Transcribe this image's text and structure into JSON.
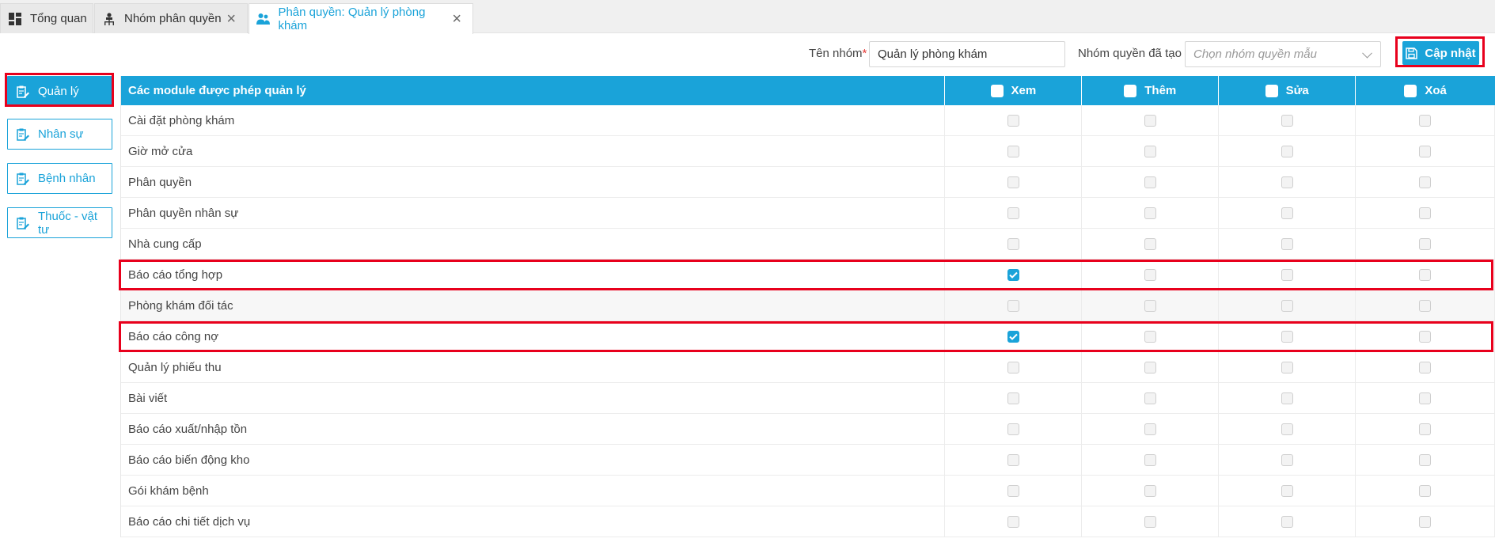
{
  "tabs": [
    {
      "label": "Tổng quan",
      "icon": "dashboard-icon"
    },
    {
      "label": "Nhóm phân quyền",
      "icon": "org-chart-icon"
    },
    {
      "label": "Phân quyền: Quản lý phòng khám",
      "icon": "users-icon"
    }
  ],
  "toolbar": {
    "group_name_label": "Tên nhóm",
    "required_mark": "*",
    "group_name_value": "Quản lý phòng khám",
    "template_label": "Nhóm quyền đã tạo :",
    "template_placeholder": "Chọn nhóm quyền mẫu",
    "update_label": "Cập nhật"
  },
  "sidebar": {
    "items": [
      {
        "label": "Quản lý",
        "active": true
      },
      {
        "label": "Nhân sự",
        "active": false
      },
      {
        "label": "Bệnh nhân",
        "active": false
      },
      {
        "label": "Thuốc - vật tư",
        "active": false
      }
    ]
  },
  "table": {
    "header": {
      "module": "Các module được phép quản lý",
      "view": "Xem",
      "add": "Thêm",
      "edit": "Sửa",
      "delete": "Xoá"
    },
    "rows": [
      {
        "module": "Cài đặt phòng khám",
        "view": false,
        "add": false,
        "edit": false,
        "delete": false
      },
      {
        "module": "Giờ mở cửa",
        "view": false,
        "add": false,
        "edit": false,
        "delete": false
      },
      {
        "module": "Phân quyền",
        "view": false,
        "add": false,
        "edit": false,
        "delete": false
      },
      {
        "module": "Phân quyền nhân sự",
        "view": false,
        "add": false,
        "edit": false,
        "delete": false
      },
      {
        "module": "Nhà cung cấp",
        "view": false,
        "add": false,
        "edit": false,
        "delete": false
      },
      {
        "module": "Báo cáo tổng hợp",
        "view": true,
        "add": false,
        "edit": false,
        "delete": false
      },
      {
        "module": "Phòng khám đối tác",
        "view": false,
        "add": false,
        "edit": false,
        "delete": false
      },
      {
        "module": "Báo cáo công nợ",
        "view": true,
        "add": false,
        "edit": false,
        "delete": false
      },
      {
        "module": "Quản lý phiếu thu",
        "view": false,
        "add": false,
        "edit": false,
        "delete": false
      },
      {
        "module": "Bài viết",
        "view": false,
        "add": false,
        "edit": false,
        "delete": false
      },
      {
        "module": "Báo cáo xuất/nhập tồn",
        "view": false,
        "add": false,
        "edit": false,
        "delete": false
      },
      {
        "module": "Báo cáo biến động kho",
        "view": false,
        "add": false,
        "edit": false,
        "delete": false
      },
      {
        "module": "Gói khám bệnh",
        "view": false,
        "add": false,
        "edit": false,
        "delete": false
      },
      {
        "module": "Báo cáo chi tiết dịch vụ",
        "view": false,
        "add": false,
        "edit": false,
        "delete": false
      }
    ]
  },
  "colors": {
    "accent": "#1aa3d9",
    "highlight": "#e8001c"
  }
}
